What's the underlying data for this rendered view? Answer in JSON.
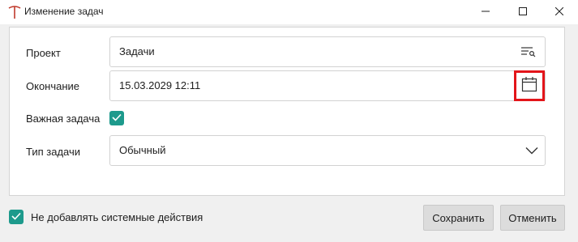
{
  "window": {
    "title": "Изменение задач",
    "app_icon": "t-letter-icon",
    "controls": [
      "minimize-icon",
      "maximize-icon",
      "close-icon"
    ]
  },
  "form": {
    "project": {
      "label": "Проект",
      "value": "Задачи",
      "icon": "list-search-icon"
    },
    "end": {
      "label": "Окончание",
      "value": "15.03.2029 12:11",
      "icon": "calendar-icon"
    },
    "important": {
      "label": "Важная задача",
      "checked": true
    },
    "type": {
      "label": "Тип задачи",
      "value": "Обычный",
      "icon": "chevron-down-icon"
    }
  },
  "footer": {
    "no_system_actions_label": "Не добавлять системные действия",
    "no_system_actions_checked": true,
    "save_label": "Сохранить",
    "cancel_label": "Отменить"
  },
  "colors": {
    "accent": "#1d9a8c",
    "highlight": "#e3151a",
    "app_icon": "#c0392b"
  }
}
